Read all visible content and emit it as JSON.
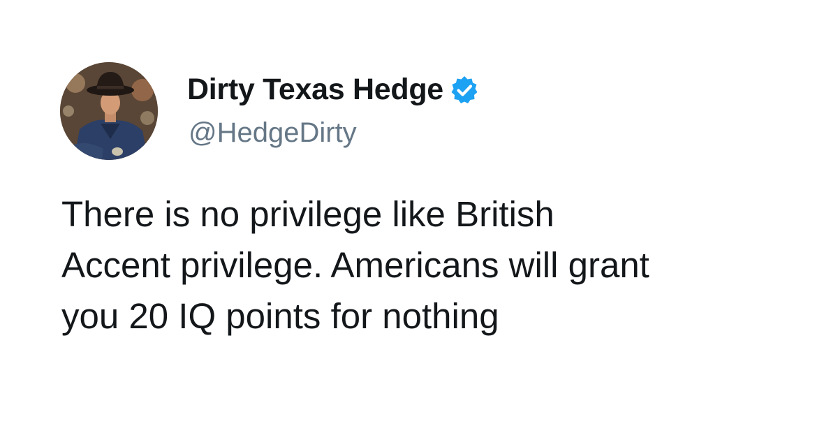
{
  "tweet": {
    "author": {
      "display_name": "Dirty Texas Hedge",
      "handle": "@HedgeDirty",
      "verified": true,
      "avatar_icon": "cowboy-portrait-avatar"
    },
    "text_lines": [
      "There is no privilege like British",
      "Accent privilege. Americans will grant",
      "you 20 IQ points for nothing"
    ]
  },
  "colors": {
    "background": "#ffffff",
    "name": "#14171a",
    "handle": "#657786",
    "body_text": "#14171a",
    "verified_badge": "#1da1f2"
  }
}
